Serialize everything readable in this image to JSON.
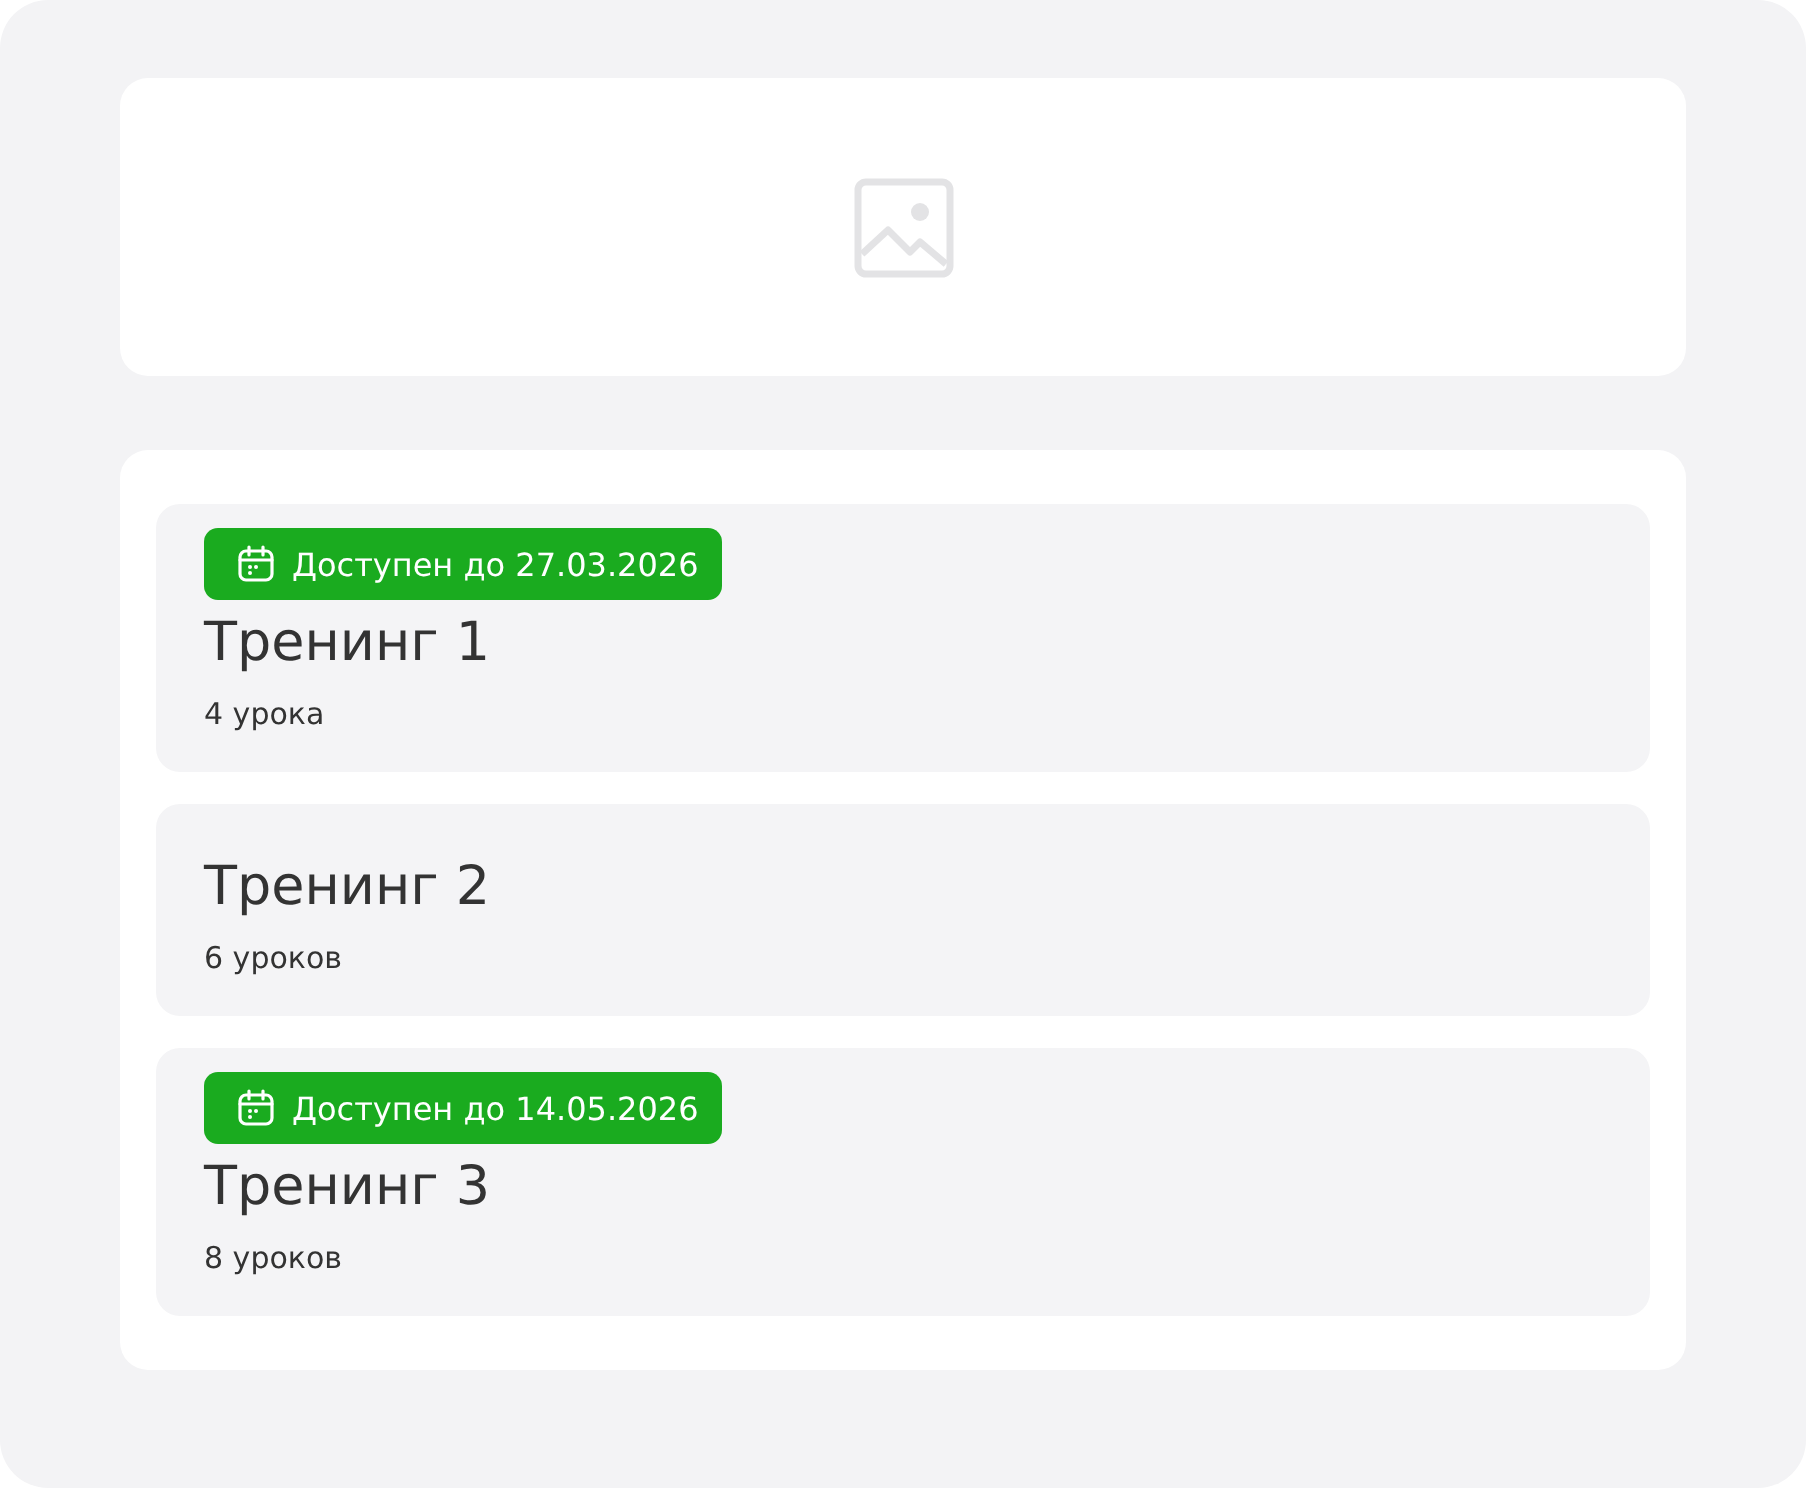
{
  "trainings": [
    {
      "badge": "Доступен до 27.03.2026",
      "title": "Тренинг 1",
      "lessons": "4 урока"
    },
    {
      "title": "Тренинг 2",
      "lessons": "6 уроков"
    },
    {
      "badge": "Доступен до 14.05.2026",
      "title": "Тренинг 3",
      "lessons": "8 уроков"
    }
  ]
}
